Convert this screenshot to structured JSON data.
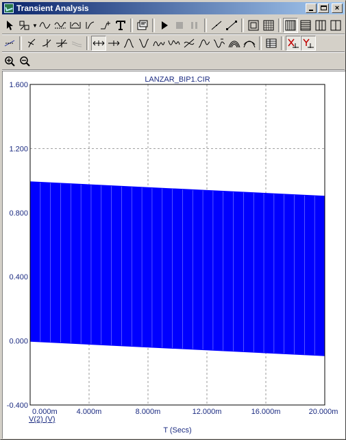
{
  "window": {
    "title": "Transient Analysis",
    "buttons": {
      "minimize": "minimize",
      "maximize": "maximize",
      "close": "×"
    }
  },
  "toolbar_row1": [
    "select-arrow-icon",
    "scale-icon",
    "waveform-edit-icon",
    "tokens-icon",
    "peak-icon",
    "slope-icon",
    "level-icon",
    "text-icon",
    "properties-icon",
    "run-icon",
    "stop-icon",
    "pause-icon",
    "line-icon",
    "diagonal-icon",
    "grid-box-icon",
    "grid-fine-icon",
    "layout-1-icon",
    "layout-2-icon",
    "layout-3-icon",
    "layout-4-icon"
  ],
  "toolbar_row2": [
    "cursor-mode-icon",
    "tag-icon",
    "tag-vertical-icon",
    "tag-horizontal-icon",
    "tag-cursor-icon",
    "cursor-left-icon",
    "cursor-right-icon",
    "peak-find-icon",
    "valley-find-icon",
    "high-icon",
    "low-icon",
    "inflection-icon",
    "global-high-icon",
    "global-low-icon",
    "top-icon",
    "bottom-icon",
    "table-icon",
    "x-scale-icon",
    "y-scale-icon"
  ],
  "toolbar_row3": [
    "zoom-in-icon",
    "zoom-out-icon"
  ],
  "colors": {
    "trace": "#0000ff",
    "axis_text": "#1a2a80",
    "grid": "#808080"
  },
  "chart_data": {
    "type": "area",
    "title": "LANZAR_BIP1.CIR",
    "xlabel": "T (Secs)",
    "ylabel": "",
    "series": [
      {
        "name": "V(2) (V)",
        "upper": [
          0.995,
          0.905
        ],
        "lower": [
          -0.005,
          -0.095
        ]
      }
    ],
    "x": [
      0.0,
      20.0
    ],
    "x_unit": "ms",
    "xlim": [
      0,
      20
    ],
    "ylim": [
      -0.4,
      1.6
    ],
    "x_ticks": [
      "0.000m",
      "4.000m",
      "8.000m",
      "12.000m",
      "16.000m",
      "20.000m"
    ],
    "x_tick_values": [
      0,
      4,
      8,
      12,
      16,
      20
    ],
    "y_ticks": [
      "-0.400",
      "0.000",
      "0.400",
      "0.800",
      "1.200",
      "1.600"
    ],
    "y_tick_values": [
      -0.4,
      0.0,
      0.4,
      0.8,
      1.2,
      1.6
    ],
    "pulse_count": 29,
    "grid": true
  }
}
